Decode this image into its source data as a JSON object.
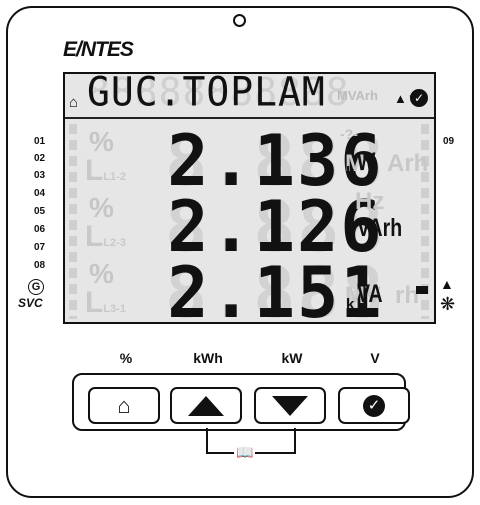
{
  "brand": "E/NTES",
  "display": {
    "top_text": "GUC.TOPLAM",
    "top_ghost": "88888888888",
    "mvarh_ghost": "MVArh",
    "home_icon": "home-icon",
    "updown_icon": "up-down-arrows-icon",
    "check_icon": "check-circle-icon",
    "rows": [
      {
        "value": "2.136",
        "prefix": "k",
        "unit": "W",
        "ghost_unit": "M",
        "ghost_after": "Arh",
        "small_ghost": "-?-"
      },
      {
        "value": "2.126",
        "prefix": "k",
        "unit": "VArh",
        "ghost_unit": "M",
        "ghost_after": "Hz",
        "small_ghost": ""
      },
      {
        "value": "2.151",
        "prefix": "k",
        "unit": "VA",
        "ghost_unit": "MV",
        "ghost_after": "rh",
        "small_ghost": ""
      }
    ],
    "ghost_digits": "8.888",
    "phase_labels": [
      "L1-2",
      "L2-3",
      "L3-1"
    ]
  },
  "left_numbers": [
    "01",
    "02",
    "03",
    "04",
    "05",
    "06",
    "07",
    "08"
  ],
  "right_number": "09",
  "g_label": "G",
  "svc_label": "SVC",
  "button_labels": [
    "%",
    "kWh",
    "kW",
    "V"
  ],
  "buttons": [
    {
      "name": "home",
      "icon": "home-icon"
    },
    {
      "name": "up",
      "icon": "up-arrow-icon"
    },
    {
      "name": "down",
      "icon": "down-arrow-icon"
    },
    {
      "name": "ok",
      "icon": "check-circle-icon"
    }
  ],
  "book_icon": "book-icon"
}
